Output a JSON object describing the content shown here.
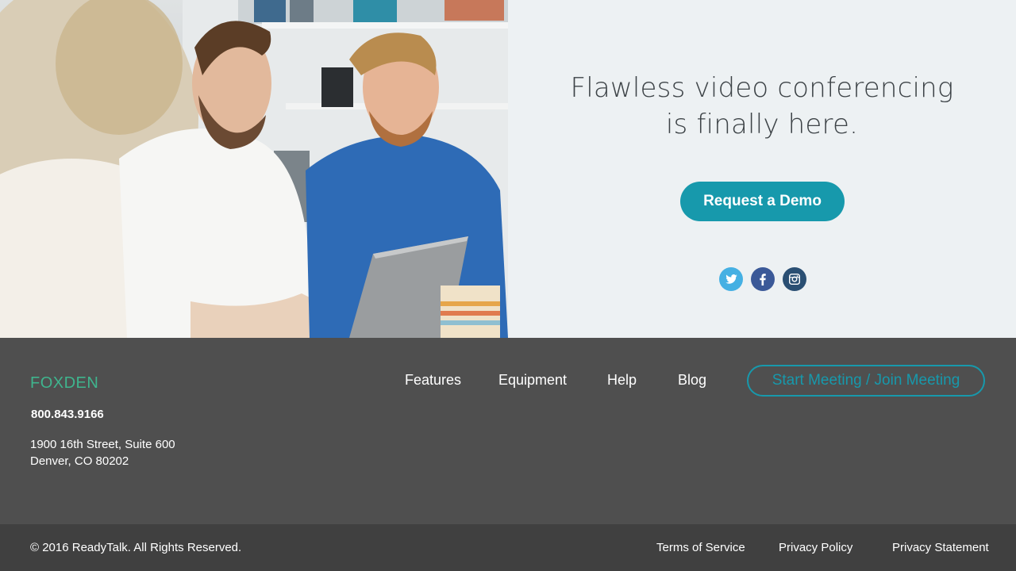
{
  "hero": {
    "headline_line1": "Flawless video conferencing",
    "headline_line2": "is finally here.",
    "cta_label": "Request a Demo",
    "social": [
      {
        "name": "twitter-icon",
        "color": "#45b0e3"
      },
      {
        "name": "facebook-icon",
        "color": "#3b5998"
      },
      {
        "name": "instagram-icon",
        "color": "#2a4f73"
      }
    ]
  },
  "footer": {
    "brand": "FOXDEN",
    "phone": "800.843.9166",
    "address_line1": "1900 16th Street, Suite 600",
    "address_line2": "Denver, CO 80202",
    "nav": [
      "Features",
      "Equipment",
      "Help",
      "Blog"
    ],
    "meeting_button": "Start Meeting / Join Meeting"
  },
  "bottom": {
    "copyright": "© 2016 ReadyTalk. All Rights Reserved.",
    "links": [
      "Terms of Service",
      "Privacy Policy",
      "Privacy Statement"
    ]
  },
  "colors": {
    "accent": "#1799ac",
    "brand_green": "#3fb58e",
    "footer_bg": "#4f4f4f",
    "bottom_bg": "#404040",
    "hero_panel_bg": "#edf1f3"
  }
}
